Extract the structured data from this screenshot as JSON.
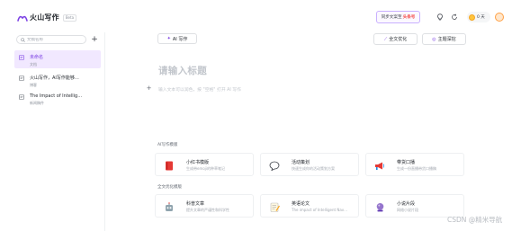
{
  "app": {
    "name": "火山写作",
    "badge": "Beta"
  },
  "topbar": {
    "sync_label": "同步文案至",
    "sync_highlight": "头条号",
    "points": "0 天"
  },
  "sidebar": {
    "search_placeholder": "文稿名称",
    "add_label": "+",
    "items": [
      {
        "title": "未命名",
        "sub": "文档"
      },
      {
        "title": "火山写作，AI写作能够…",
        "sub": "博客"
      },
      {
        "title": "The Impact of Intellig…",
        "sub": "新闻稿件"
      }
    ]
  },
  "editor": {
    "ai_button": "AI 写作",
    "polish_button": "全文优化",
    "theme_button": "主题深挖",
    "title_placeholder": "请输入标题",
    "body_placeholder": "输入文本可以润色，按 \"空格\" 打开 AI 写作",
    "plus": "+"
  },
  "templates": {
    "ai_label": "AI写作模版",
    "ai_cards": [
      {
        "title": "小红书模版",
        "desc": "生成带emoji的种草笔记"
      },
      {
        "title": "活动策划",
        "desc": "快速生成你的活动策划方案"
      },
      {
        "title": "带货口播",
        "desc": "生成一份直播带货口播稿"
      }
    ],
    "polish_label": "全文优化模版",
    "polish_cards": [
      {
        "title": "科普文章",
        "desc": "提升文章的严谨性和科学性"
      },
      {
        "title": "英语论文",
        "desc": "The impact of Intelligent Nav…"
      },
      {
        "title": "小说片段",
        "desc": "网络小说片段"
      }
    ]
  },
  "watermark": "CSDN @精米导航",
  "colors": {
    "accent": "#7b3fe4",
    "highlight": "#f54a45",
    "selected_bg": "#f1e8ff"
  }
}
